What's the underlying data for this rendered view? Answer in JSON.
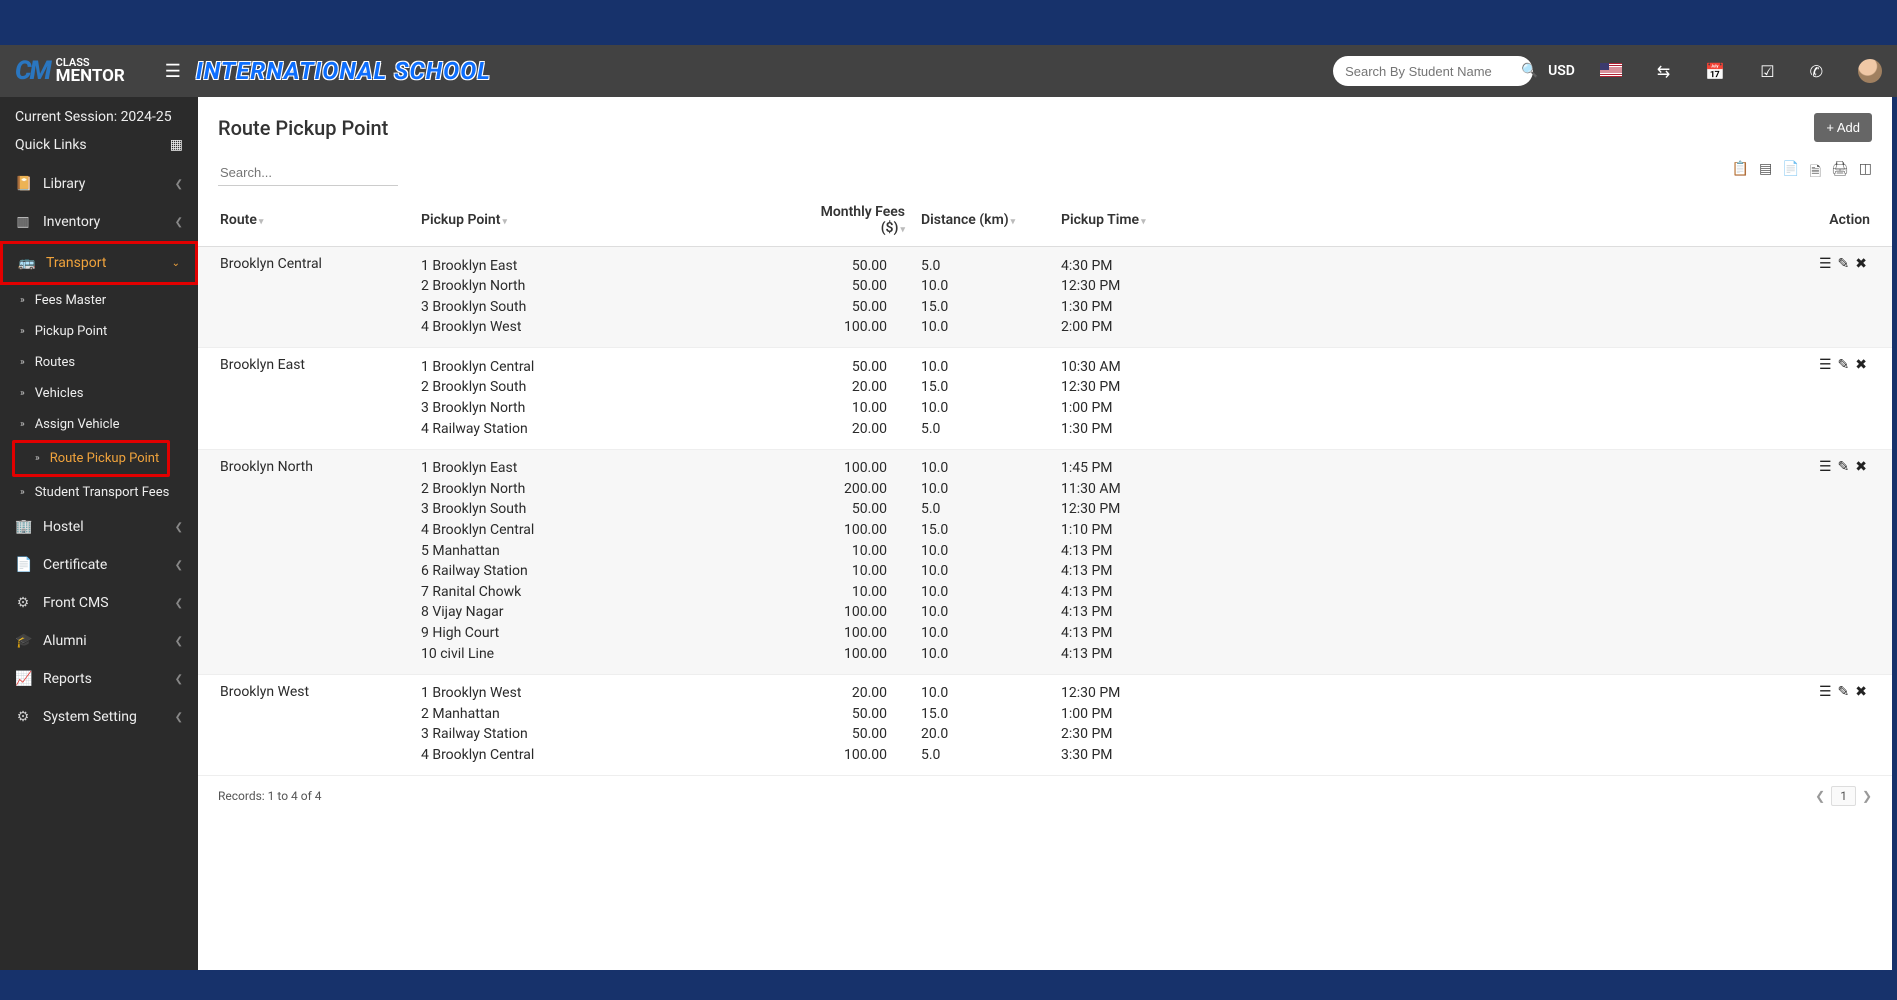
{
  "header": {
    "logo_small": "CLASS",
    "logo_big": "MENTOR",
    "school_name": "INTERNATIONAL SCHOOL",
    "search_placeholder": "Search By Student Name",
    "currency": "USD"
  },
  "sidebar": {
    "session": "Current Session: 2024-25",
    "quick_links": "Quick Links",
    "library": "Library",
    "inventory": "Inventory",
    "transport": "Transport",
    "sub": {
      "fees_master": "Fees Master",
      "pickup_point": "Pickup Point",
      "routes": "Routes",
      "vehicles": "Vehicles",
      "assign_vehicle": "Assign Vehicle",
      "route_pickup_point": "Route Pickup Point",
      "student_transport_fees": "Student Transport Fees"
    },
    "hostel": "Hostel",
    "certificate": "Certificate",
    "front_cms": "Front CMS",
    "alumni": "Alumni",
    "reports": "Reports",
    "system_setting": "System Setting"
  },
  "page": {
    "title": "Route Pickup Point",
    "add_btn": "+ Add",
    "search_placeholder": "Search...",
    "columns": {
      "route": "Route",
      "pickup": "Pickup Point",
      "fees": "Monthly Fees ($)",
      "distance": "Distance (km)",
      "time": "Pickup Time",
      "action": "Action"
    },
    "rows": [
      {
        "route": "Brooklyn Central",
        "points": [
          {
            "idx": "1",
            "name": "Brooklyn East",
            "fee": "50.00",
            "dist": "5.0",
            "time": "4:30 PM"
          },
          {
            "idx": "2",
            "name": "Brooklyn North",
            "fee": "50.00",
            "dist": "10.0",
            "time": "12:30 PM"
          },
          {
            "idx": "3",
            "name": "Brooklyn South",
            "fee": "50.00",
            "dist": "15.0",
            "time": "1:30 PM"
          },
          {
            "idx": "4",
            "name": "Brooklyn West",
            "fee": "100.00",
            "dist": "10.0",
            "time": "2:00 PM"
          }
        ]
      },
      {
        "route": "Brooklyn East",
        "points": [
          {
            "idx": "1",
            "name": "Brooklyn Central",
            "fee": "50.00",
            "dist": "10.0",
            "time": "10:30 AM"
          },
          {
            "idx": "2",
            "name": "Brooklyn South",
            "fee": "20.00",
            "dist": "15.0",
            "time": "12:30 PM"
          },
          {
            "idx": "3",
            "name": "Brooklyn North",
            "fee": "10.00",
            "dist": "10.0",
            "time": "1:00 PM"
          },
          {
            "idx": "4",
            "name": "Railway Station",
            "fee": "20.00",
            "dist": "5.0",
            "time": "1:30 PM"
          }
        ]
      },
      {
        "route": "Brooklyn North",
        "points": [
          {
            "idx": "1",
            "name": "Brooklyn East",
            "fee": "100.00",
            "dist": "10.0",
            "time": "1:45 PM"
          },
          {
            "idx": "2",
            "name": "Brooklyn North",
            "fee": "200.00",
            "dist": "10.0",
            "time": "11:30 AM"
          },
          {
            "idx": "3",
            "name": "Brooklyn South",
            "fee": "50.00",
            "dist": "5.0",
            "time": "12:30 PM"
          },
          {
            "idx": "4",
            "name": "Brooklyn Central",
            "fee": "100.00",
            "dist": "15.0",
            "time": "1:10 PM"
          },
          {
            "idx": "5",
            "name": "Manhattan",
            "fee": "10.00",
            "dist": "10.0",
            "time": "4:13 PM"
          },
          {
            "idx": "6",
            "name": "Railway Station",
            "fee": "10.00",
            "dist": "10.0",
            "time": "4:13 PM"
          },
          {
            "idx": "7",
            "name": "Ranital Chowk",
            "fee": "10.00",
            "dist": "10.0",
            "time": "4:13 PM"
          },
          {
            "idx": "8",
            "name": "Vijay Nagar",
            "fee": "100.00",
            "dist": "10.0",
            "time": "4:13 PM"
          },
          {
            "idx": "9",
            "name": "High Court",
            "fee": "100.00",
            "dist": "10.0",
            "time": "4:13 PM"
          },
          {
            "idx": "10",
            "name": "civil Line",
            "fee": "100.00",
            "dist": "10.0",
            "time": "4:13 PM"
          }
        ]
      },
      {
        "route": "Brooklyn West",
        "points": [
          {
            "idx": "1",
            "name": "Brooklyn West",
            "fee": "20.00",
            "dist": "10.0",
            "time": "12:30 PM"
          },
          {
            "idx": "2",
            "name": "Manhattan",
            "fee": "50.00",
            "dist": "15.0",
            "time": "1:00 PM"
          },
          {
            "idx": "3",
            "name": "Railway Station",
            "fee": "50.00",
            "dist": "20.0",
            "time": "2:30 PM"
          },
          {
            "idx": "4",
            "name": "Brooklyn Central",
            "fee": "100.00",
            "dist": "5.0",
            "time": "3:30 PM"
          }
        ]
      }
    ],
    "records": "Records: 1 to 4 of 4",
    "page_no": "1"
  }
}
